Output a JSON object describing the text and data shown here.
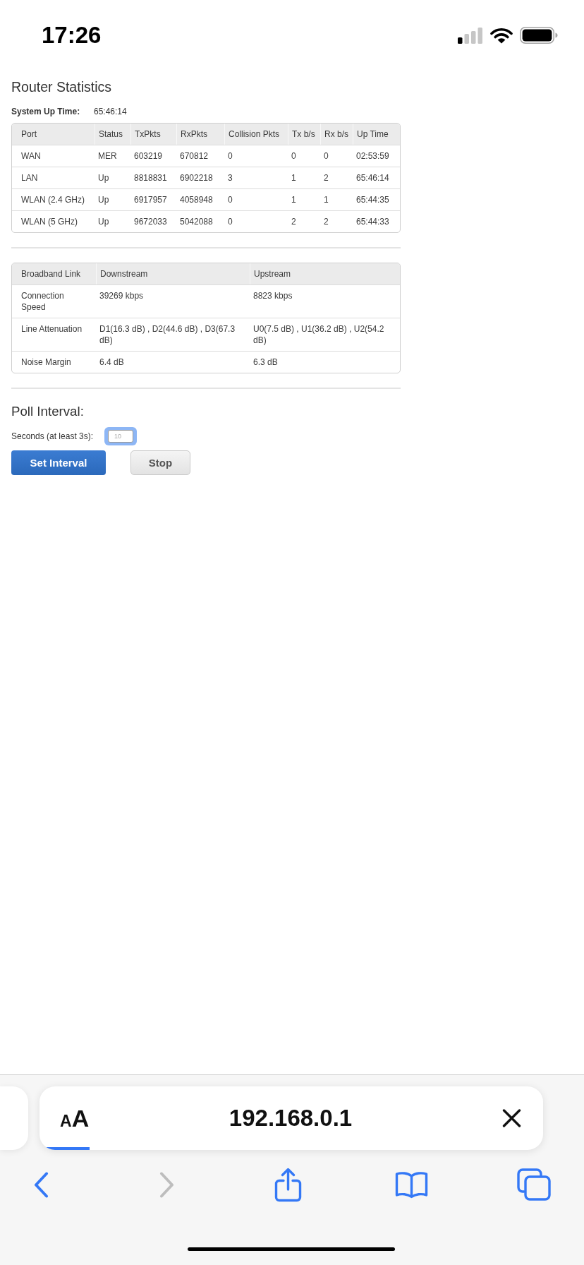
{
  "status_bar": {
    "time": "17:26"
  },
  "page": {
    "title": "Router Statistics",
    "system_up_time": {
      "label": "System Up Time:",
      "value": "65:46:14"
    },
    "port_table": {
      "columns": [
        "Port",
        "Status",
        "TxPkts",
        "RxPkts",
        "Collision Pkts",
        "Tx b/s",
        "Rx b/s",
        "Up Time"
      ],
      "rows": [
        [
          "WAN",
          "MER",
          "603219",
          "670812",
          "0",
          "0",
          "0",
          "02:53:59"
        ],
        [
          "LAN",
          "Up",
          "8818831",
          "6902218",
          "3",
          "1",
          "2",
          "65:46:14"
        ],
        [
          "WLAN (2.4 GHz)",
          "Up",
          "6917957",
          "4058948",
          "0",
          "1",
          "1",
          "65:44:35"
        ],
        [
          "WLAN (5 GHz)",
          "Up",
          "9672033",
          "5042088",
          "0",
          "2",
          "2",
          "65:44:33"
        ]
      ]
    },
    "link_table": {
      "columns": [
        "Broadband Link",
        "Downstream",
        "Upstream"
      ],
      "rows": [
        [
          "Connection Speed",
          "39269 kbps",
          "8823 kbps"
        ],
        [
          "Line Attenuation",
          "D1(16.3 dB) , D2(44.6 dB) , D3(67.3 dB)",
          "U0(7.5 dB) , U1(36.2 dB) , U2(54.2 dB)"
        ],
        [
          "Noise Margin",
          "6.4 dB",
          "6.3 dB"
        ]
      ]
    },
    "poll_interval": {
      "title": "Poll Interval:",
      "seconds_label": "Seconds (at least 3s):",
      "seconds_field": {
        "placeholder": "10",
        "focused": true
      },
      "buttons": [
        {
          "label": "Set Interval",
          "kind": "primary"
        },
        {
          "label": "Stop",
          "kind": "secondary"
        }
      ]
    }
  },
  "browser": {
    "address_bar": {
      "text_size_button": "AA",
      "url": "192.168.0.1",
      "load_progress": {
        "level": 0.1
      }
    },
    "toolbar": [
      {
        "kind": "back",
        "disabled": false
      },
      {
        "kind": "forward",
        "disabled": true
      },
      {
        "kind": "share",
        "disabled": false
      },
      {
        "kind": "bookmarks",
        "disabled": false
      },
      {
        "kind": "tabs",
        "disabled": false
      }
    ]
  }
}
